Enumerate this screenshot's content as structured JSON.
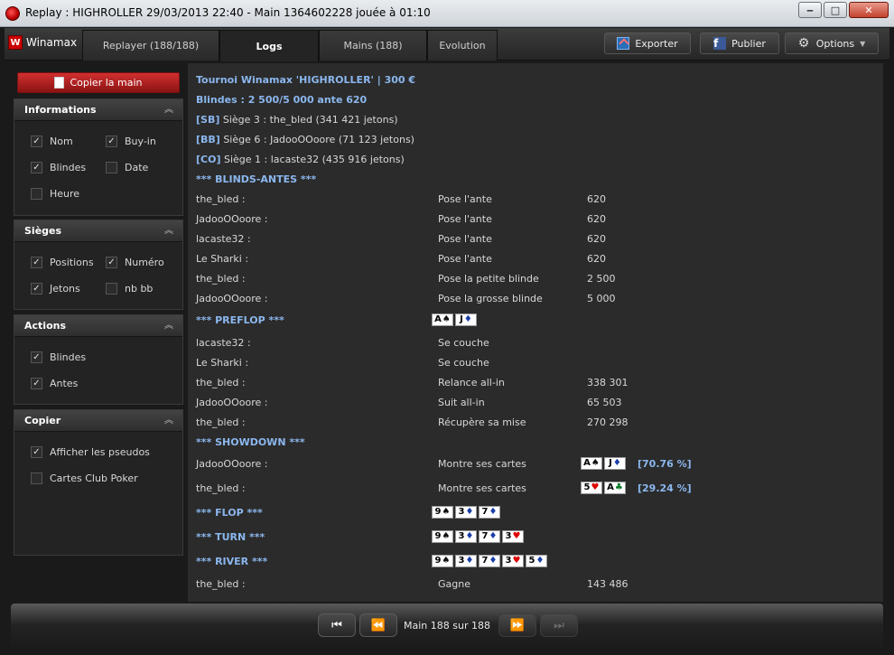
{
  "window": {
    "title": "Replay : HIGHROLLER 29/03/2013 22:40 - Main 1364602228 jouée à  01:10"
  },
  "brand": "Winamax",
  "tabs": [
    {
      "label": "Replayer (188/188)"
    },
    {
      "label": "Logs"
    },
    {
      "label": "Mains (188)"
    },
    {
      "label": "Evolution"
    }
  ],
  "toolbar": {
    "export": "Exporter",
    "publish": "Publier",
    "options": "Options"
  },
  "sidebar": {
    "copy_label": "Copier la main",
    "informations": {
      "title": "Informations",
      "nom": "Nom",
      "buyin": "Buy-in",
      "blindes": "Blindes",
      "date": "Date",
      "heure": "Heure"
    },
    "sieges": {
      "title": "Sièges",
      "positions": "Positions",
      "numero": "Numéro",
      "jetons": "Jetons",
      "nbbb": "nb bb"
    },
    "actions": {
      "title": "Actions",
      "blindes": "Blindes",
      "antes": "Antes"
    },
    "copier": {
      "title": "Copier",
      "pseudos": "Afficher les pseudos",
      "club": "Cartes Club Poker"
    }
  },
  "log": {
    "line1": "Tournoi Winamax 'HIGHROLLER' | 300 €",
    "line2": "Blindes : 2 500/5 000 ante 620",
    "seats": [
      {
        "tag": "[SB]",
        "text": " Siège 3 : the_bled (341 421 jetons)"
      },
      {
        "tag": "[BB]",
        "text": " Siège 6 : JadooOOoore (71 123 jetons)"
      },
      {
        "tag": "[CO]",
        "text": " Siège 1 : lacaste32 (435 916 jetons)"
      }
    ],
    "sec_blinds": "*** BLINDS-ANTES ***",
    "blind_rows": [
      {
        "p": "the_bled :",
        "a": "Pose l'ante",
        "v": "620"
      },
      {
        "p": "JadooOOoore :",
        "a": "Pose l'ante",
        "v": "620"
      },
      {
        "p": "lacaste32 :",
        "a": "Pose l'ante",
        "v": "620"
      },
      {
        "p": "Le Sharki :",
        "a": "Pose l'ante",
        "v": "620"
      },
      {
        "p": "the_bled :",
        "a": "Pose la petite blinde",
        "v": "2 500"
      },
      {
        "p": "JadooOOoore :",
        "a": "Pose la grosse blinde",
        "v": "5 000"
      }
    ],
    "sec_preflop": "*** PREFLOP ***",
    "preflop_rows": [
      {
        "p": "lacaste32 :",
        "a": "Se couche",
        "v": ""
      },
      {
        "p": "Le Sharki :",
        "a": "Se couche",
        "v": ""
      },
      {
        "p": "the_bled :",
        "a": "Relance all-in",
        "v": "338 301"
      },
      {
        "p": "JadooOOoore :",
        "a": "Suit all-in",
        "v": "65 503"
      },
      {
        "p": "the_bled :",
        "a": "Récupère sa mise",
        "v": "270 298"
      }
    ],
    "sec_showdown": "*** SHOWDOWN ***",
    "show1": {
      "p": "JadooOOoore :",
      "a": "Montre ses cartes",
      "pct": "[70.76 %]"
    },
    "show2": {
      "p": "the_bled :",
      "a": "Montre ses cartes",
      "pct": "[29.24 %]"
    },
    "sec_flop": "*** FLOP ***",
    "sec_turn": "*** TURN ***",
    "sec_river": "*** RIVER ***",
    "final": {
      "p": "the_bled :",
      "a": "Gagne",
      "v": "143 486"
    }
  },
  "cards": {
    "hero": [
      {
        "r": "A",
        "s": "♠"
      },
      {
        "r": "J",
        "s": "♦"
      }
    ],
    "show1": [
      {
        "r": "A",
        "s": "♠"
      },
      {
        "r": "J",
        "s": "♦"
      }
    ],
    "show2": [
      {
        "r": "5",
        "s": "♥"
      },
      {
        "r": "A",
        "s": "♣"
      }
    ],
    "flop": [
      {
        "r": "9",
        "s": "♠"
      },
      {
        "r": "3",
        "s": "♦"
      },
      {
        "r": "7",
        "s": "♦"
      }
    ],
    "turn": [
      {
        "r": "9",
        "s": "♠"
      },
      {
        "r": "3",
        "s": "♦"
      },
      {
        "r": "7",
        "s": "♦"
      },
      {
        "r": "3",
        "s": "♥"
      }
    ],
    "river": [
      {
        "r": "9",
        "s": "♠"
      },
      {
        "r": "3",
        "s": "♦"
      },
      {
        "r": "7",
        "s": "♦"
      },
      {
        "r": "3",
        "s": "♥"
      },
      {
        "r": "5",
        "s": "♦"
      }
    ]
  },
  "footer": {
    "pager": "Main 188 sur 188"
  },
  "colors": {
    "accent_blue": "#8bb7ee",
    "copy_red": "#c02020"
  }
}
